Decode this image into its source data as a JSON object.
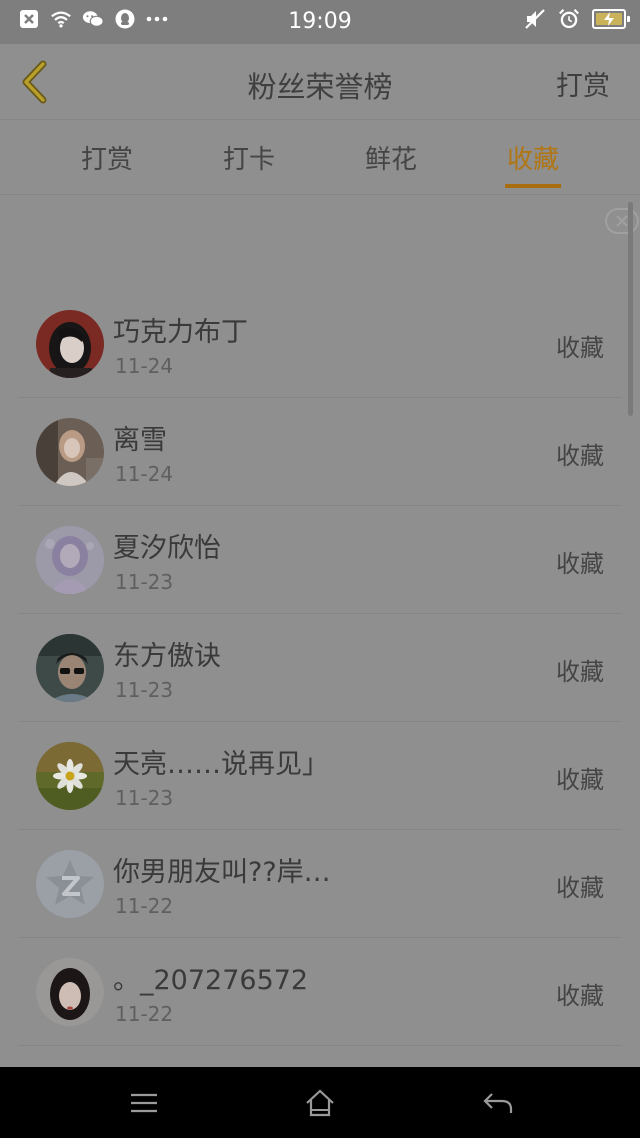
{
  "status": {
    "time": "19:09"
  },
  "header": {
    "title": "粉丝荣誉榜",
    "action": "打赏"
  },
  "tabs": [
    {
      "label": "打赏",
      "active": false
    },
    {
      "label": "打卡",
      "active": false
    },
    {
      "label": "鲜花",
      "active": false
    },
    {
      "label": "收藏",
      "active": true
    }
  ],
  "colors": {
    "accent": "#b07614",
    "overlay": "#8f8f8f",
    "navbar": "#000000"
  },
  "fans": [
    {
      "name": "巧克力布丁",
      "date": "11-24",
      "tag": "收藏",
      "avatar": "avatar-girl-red"
    },
    {
      "name": "离雪",
      "date": "11-24",
      "tag": "收藏",
      "avatar": "avatar-girl-light"
    },
    {
      "name": "夏汐欣怡",
      "date": "11-23",
      "tag": "收藏",
      "avatar": "avatar-anime-purple"
    },
    {
      "name": "东方傲诀",
      "date": "11-23",
      "tag": "收藏",
      "avatar": "avatar-boy-glasses"
    },
    {
      "name": "天亮……说再见」",
      "date": "11-23",
      "tag": "收藏",
      "avatar": "avatar-daisy"
    },
    {
      "name": "你男朋友叫??岸…",
      "date": "11-22",
      "tag": "收藏",
      "avatar": "avatar-default-qzone"
    },
    {
      "name": "。_207276572",
      "date": "11-22",
      "tag": "收藏",
      "avatar": "avatar-girl-dark"
    }
  ]
}
